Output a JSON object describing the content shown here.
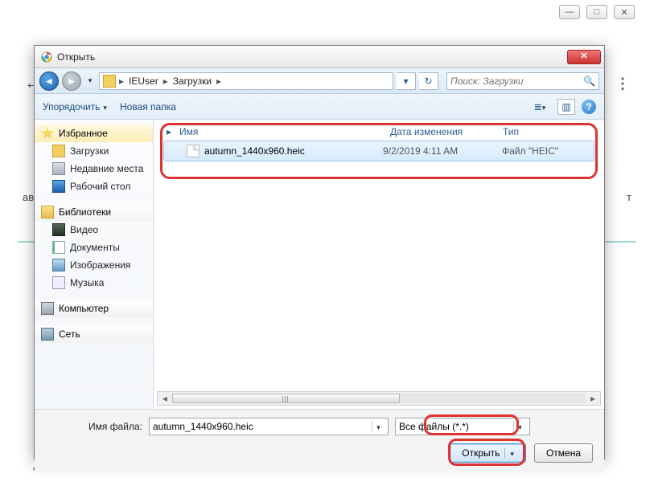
{
  "browser": {
    "side_left": "ав",
    "side_right": "т"
  },
  "dialog": {
    "title": "Открыть",
    "breadcrumb": {
      "user": "IEUser",
      "folder": "Загрузки"
    },
    "search_placeholder": "Поиск: Загрузки",
    "toolbar": {
      "organize": "Упорядочить",
      "new_folder": "Новая папка"
    },
    "columns": {
      "name": "Имя",
      "date": "Дата изменения",
      "type": "Тип"
    },
    "file": {
      "name": "autumn_1440x960.heic",
      "date": "9/2/2019 4:11 AM",
      "type": "Файл \"HEIC\""
    },
    "sidebar": {
      "favorites": "Избранное",
      "downloads": "Загрузки",
      "recent": "Недавние места",
      "desktop": "Рабочий стол",
      "libraries": "Библиотеки",
      "video": "Видео",
      "documents": "Документы",
      "pictures": "Изображения",
      "music": "Музыка",
      "computer": "Компьютер",
      "network": "Сеть"
    },
    "controls": {
      "filename_label": "Имя файла:",
      "filename_value": "autumn_1440x960.heic",
      "filter_value": "Все файлы (*.*)",
      "open": "Открыть",
      "cancel": "Отмена"
    }
  }
}
